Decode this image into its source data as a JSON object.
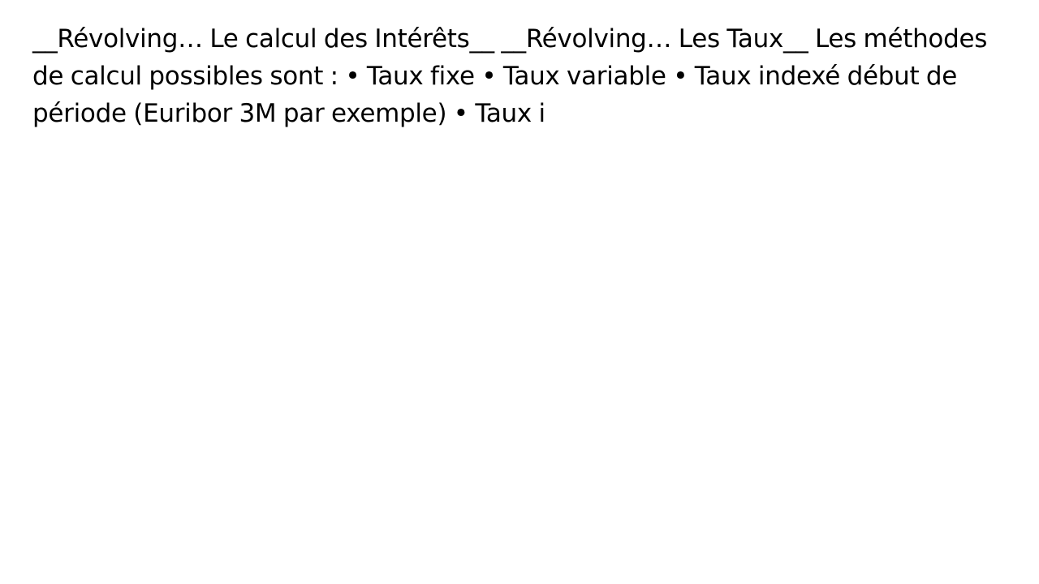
{
  "slide": {
    "text": "__Révolving… Le calcul des Intérêts__ __Révolving… Les Taux__ Les méthodes de calcul possibles sont : • Taux fixe • Taux variable • Taux indexé début de période (Euribor 3M par exemple) • Taux i"
  }
}
